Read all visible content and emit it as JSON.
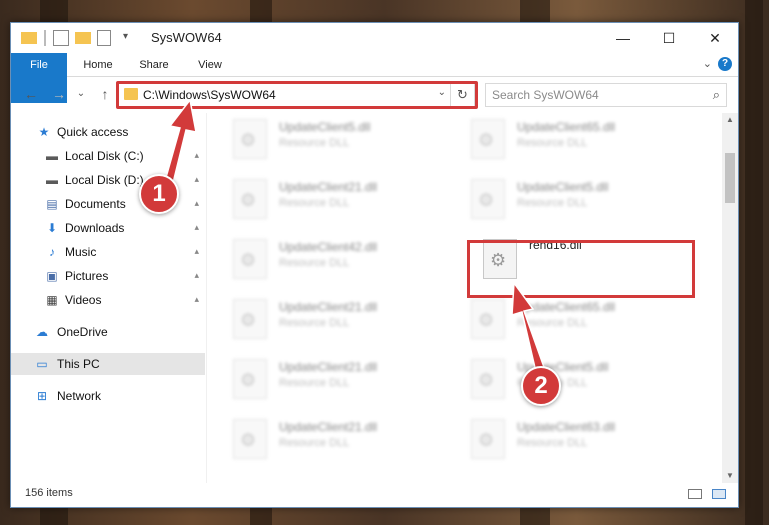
{
  "window": {
    "title": "SysWOW64"
  },
  "window_controls": {
    "minimize": "—",
    "maximize": "☐",
    "close": "✕"
  },
  "ribbon": {
    "tabs": [
      "File",
      "Home",
      "Share",
      "View"
    ],
    "expand_icon": "⌄",
    "help": "?"
  },
  "nav": {
    "back": "←",
    "forward": "→",
    "recent": "⌄",
    "up": "↑"
  },
  "address": {
    "path": "C:\\Windows\\SysWOW64",
    "dropdown": "⌄",
    "refresh": "↻"
  },
  "search": {
    "placeholder": "Search SysWOW64",
    "icon": "⌕"
  },
  "sidebar": {
    "items": [
      {
        "label": "Quick access",
        "icon": "★",
        "icon_name": "star-icon",
        "color": "#2b7cd3"
      },
      {
        "label": "Local Disk (C:)",
        "icon": "▬",
        "icon_name": "drive-icon",
        "color": "#5a5a5a",
        "pinned": true
      },
      {
        "label": "Local Disk (D:)",
        "icon": "▬",
        "icon_name": "drive-icon",
        "color": "#5a5a5a",
        "pinned": true
      },
      {
        "label": "Documents",
        "icon": "▤",
        "icon_name": "documents-icon",
        "color": "#4a6ea8",
        "pinned": true
      },
      {
        "label": "Downloads",
        "icon": "⬇",
        "icon_name": "downloads-icon",
        "color": "#2b7cd3",
        "pinned": true
      },
      {
        "label": "Music",
        "icon": "♪",
        "icon_name": "music-icon",
        "color": "#2b7cd3",
        "pinned": true
      },
      {
        "label": "Pictures",
        "icon": "▣",
        "icon_name": "pictures-icon",
        "color": "#4a6ea8",
        "pinned": true
      },
      {
        "label": "Videos",
        "icon": "▦",
        "icon_name": "videos-icon",
        "color": "#444",
        "pinned": true
      },
      {
        "label": "OneDrive",
        "icon": "☁",
        "icon_name": "onedrive-icon",
        "color": "#2b7cd3"
      },
      {
        "label": "This PC",
        "icon": "▭",
        "icon_name": "this-pc-icon",
        "color": "#2b7cd3",
        "selected": true
      },
      {
        "label": "Network",
        "icon": "⊞",
        "icon_name": "network-icon",
        "color": "#2b7cd3"
      }
    ],
    "pin_icon": "📌"
  },
  "files": [
    {
      "name": "UpdateClient5.dll",
      "type": "Resource DLL"
    },
    {
      "name": "UpdateClient65.dll",
      "type": "Resource DLL"
    },
    {
      "name": "UpdateClient21.dll",
      "type": "Resource DLL"
    },
    {
      "name": "UpdateClient5.dll",
      "type": "Resource DLL"
    },
    {
      "name": "UpdateClient42.dll",
      "type": "Resource DLL"
    },
    {
      "name": "rend16.dll",
      "type": "",
      "highlighted": true
    },
    {
      "name": "UpdateClient21.dll",
      "type": "Resource DLL"
    },
    {
      "name": "UpdateClient65.dll",
      "type": "Resource DLL"
    },
    {
      "name": "UpdateClient21.dll",
      "type": "Resource DLL"
    },
    {
      "name": "UpdateClient5.dll",
      "type": "Resource DLL"
    },
    {
      "name": "UpdateClient21.dll",
      "type": "Resource DLL"
    },
    {
      "name": "UpdateClient63.dll",
      "type": "Resource DLL"
    }
  ],
  "status": {
    "count": "156 items"
  },
  "annotations": {
    "step1": "1",
    "step2": "2",
    "color": "#d23a3a"
  }
}
